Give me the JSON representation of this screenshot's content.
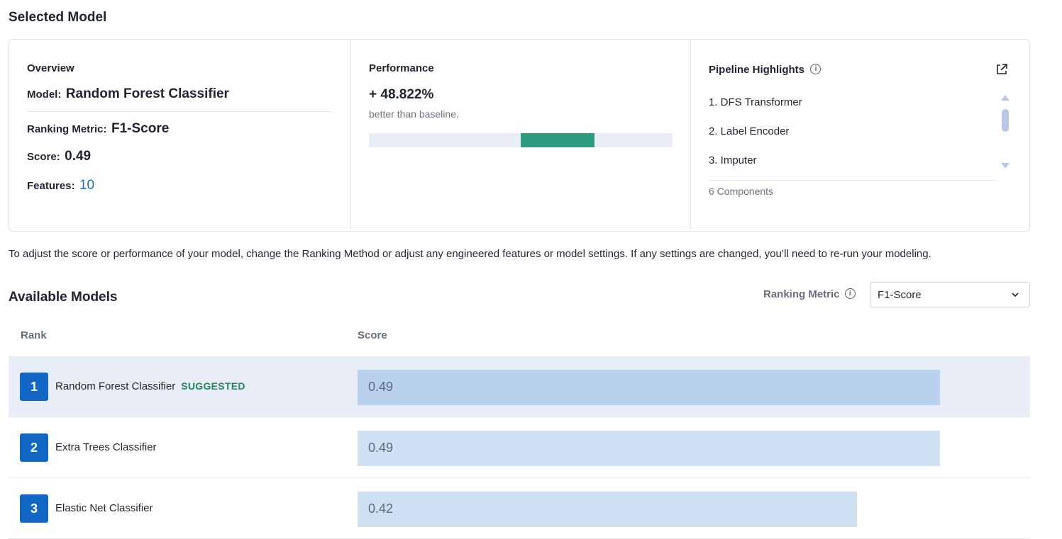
{
  "selected_model": {
    "section_title": "Selected Model",
    "overview": {
      "heading": "Overview",
      "model_label": "Model:",
      "model_value": "Random Forest Classifier",
      "ranking_metric_label": "Ranking Metric:",
      "ranking_metric_value": "F1-Score",
      "score_label": "Score:",
      "score_value": "0.49",
      "features_label": "Features:",
      "features_value": "10"
    },
    "performance": {
      "heading": "Performance",
      "value": "+ 48.822%",
      "caption": "better than baseline.",
      "bar": {
        "baseline_fraction": 0.5,
        "gain_fraction": 0.244,
        "fill_color": "#2e9a7e",
        "track_color": "#e8edf7"
      }
    },
    "pipeline": {
      "heading": "Pipeline Highlights",
      "info_icon": "info-icon",
      "external_icon": "external-link-icon",
      "items": [
        "1. DFS Transformer",
        "2. Label Encoder",
        "3. Imputer"
      ],
      "components_count": "6 Components"
    }
  },
  "note": "To adjust the score or performance of your model, change the Ranking Method or adjust any engineered features or model settings. If any settings are changed, you’ll need to re-run your modeling.",
  "available_models": {
    "section_title": "Available Models",
    "ranking_metric_label": "Ranking Metric",
    "ranking_metric_select": "F1-Score",
    "columns": {
      "rank": "Rank",
      "score": "Score"
    },
    "rows": [
      {
        "rank": "1",
        "name": "Random Forest Classifier",
        "badge": "SUGGESTED",
        "score": "0.49",
        "score_value": 0.49,
        "selected": true
      },
      {
        "rank": "2",
        "name": "Extra Trees Classifier",
        "badge": "",
        "score": "0.49",
        "score_value": 0.49,
        "selected": false
      },
      {
        "rank": "3",
        "name": "Elastic Net Classifier",
        "badge": "",
        "score": "0.42",
        "score_value": 0.42,
        "selected": false
      }
    ]
  },
  "colors": {
    "accent": "#1266c4",
    "success": "#1e8a5a",
    "link": "#1f6fc5"
  }
}
